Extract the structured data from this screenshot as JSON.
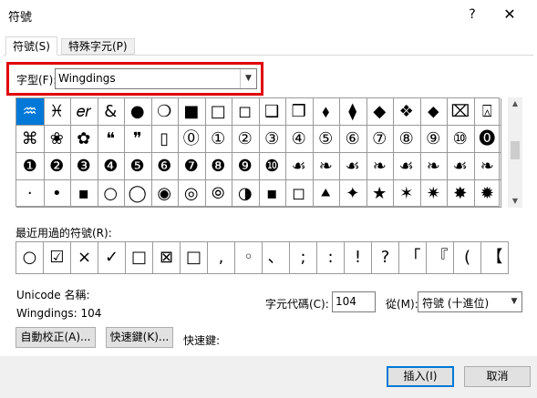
{
  "window": {
    "title": "符號",
    "help_label": "?",
    "close_label": "✕"
  },
  "tabs": [
    {
      "label": "符號(S)",
      "active": true
    },
    {
      "label": "特殊字元(P)",
      "active": false
    }
  ],
  "font": {
    "label": "字型(F):",
    "value": "Wingdings"
  },
  "symbol_rows": [
    [
      "♒",
      "♓",
      "𝑒𝑟",
      "&",
      "●",
      "❍",
      "■",
      "□",
      "◻",
      "❑",
      "❒",
      "⬧",
      "⧫",
      "◆",
      "❖",
      "⬥",
      "⌧",
      "⍓"
    ],
    [
      "⌘",
      "❀",
      "✿",
      "❝",
      "❞",
      "▯",
      "⓪",
      "①",
      "②",
      "③",
      "④",
      "⑤",
      "⑥",
      "⑦",
      "⑧",
      "⑨",
      "⑩",
      "⓿"
    ],
    [
      "❶",
      "❷",
      "❸",
      "❹",
      "❺",
      "❻",
      "❼",
      "❽",
      "❾",
      "❿",
      "☙",
      "❧",
      "☙",
      "❧",
      "☙",
      "❧",
      "☙",
      "❧"
    ],
    [
      "·",
      "•",
      "▪",
      "○",
      "◯",
      "◉",
      "◎",
      "⦾",
      "◑",
      "▪",
      "◻",
      "⯅",
      "✦",
      "★",
      "✶",
      "✷",
      "✸",
      "✹"
    ]
  ],
  "selected_index": 0,
  "recent": {
    "label": "最近用過的符號(R):",
    "symbols": [
      "○",
      "☑",
      "×",
      "✓",
      "□",
      "⊠",
      "□",
      ",",
      "◦",
      "、",
      ";",
      ":",
      "!",
      "?",
      "「",
      "『",
      "(",
      "【"
    ]
  },
  "unicode_name": {
    "label": "Unicode 名稱:",
    "value": "Wingdings: 104"
  },
  "char_code": {
    "label": "字元代碼(C):",
    "value": "104"
  },
  "from": {
    "label": "從(M):",
    "value": "符號 (十進位)"
  },
  "buttons": {
    "autocorrect": "自動校正(A)...",
    "shortcut_key": "快速鍵(K)...",
    "shortcut_label": "快速鍵:",
    "insert": "插入(I)",
    "cancel": "取消"
  }
}
